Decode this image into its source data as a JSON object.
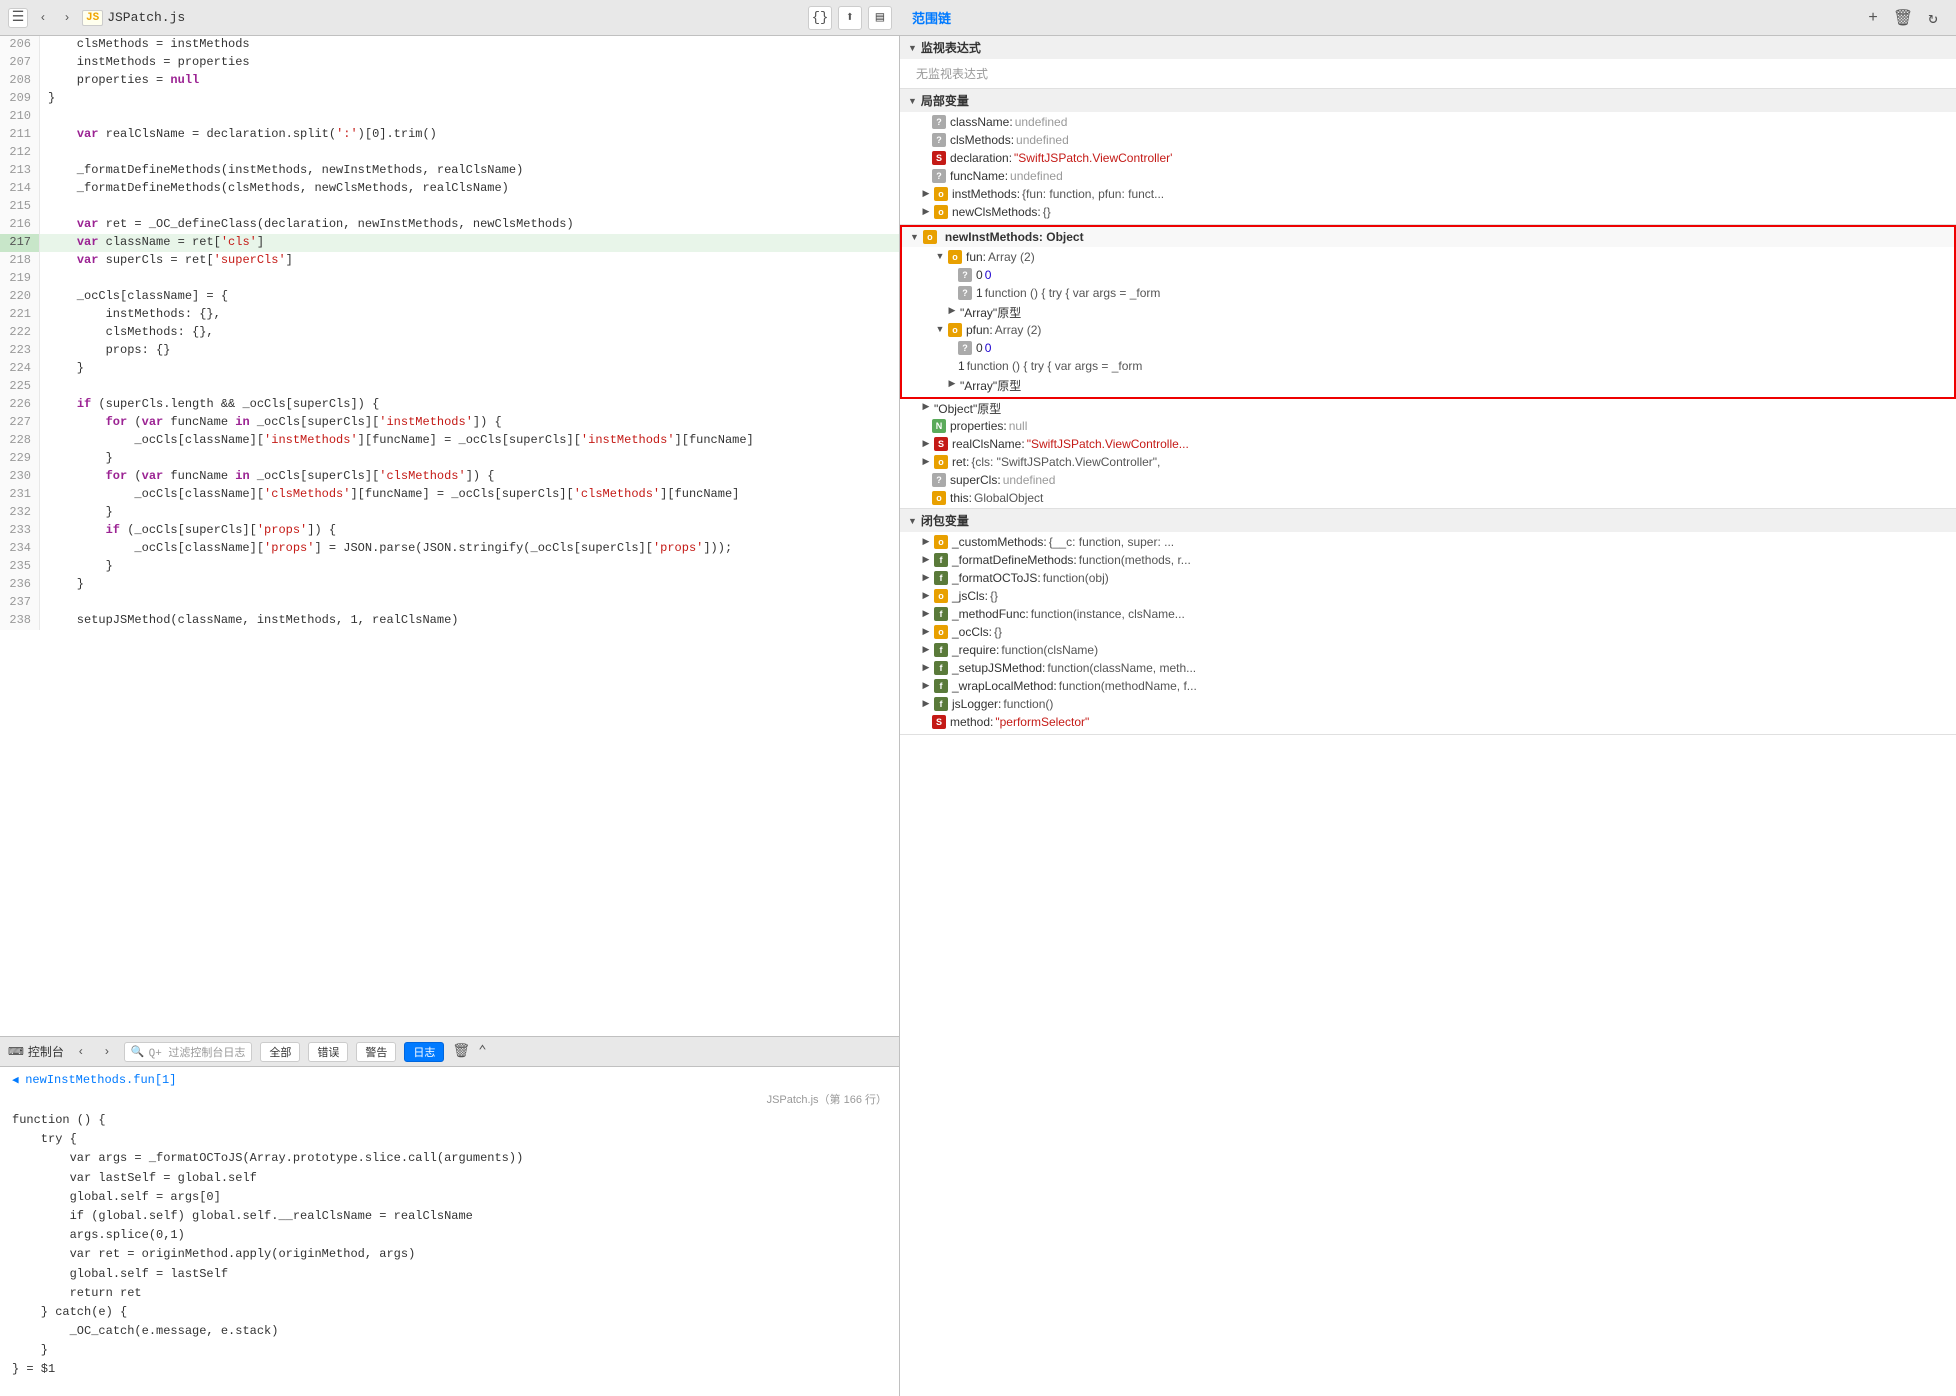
{
  "toolbar": {
    "left_icon": "≡",
    "back_arrow": "‹",
    "forward_arrow": "›",
    "js_icon": "JS",
    "filename": "JSPatch.js",
    "btn_braces": "{}",
    "btn_up": "⬆",
    "btn_sidebar": "▤"
  },
  "right_panel": {
    "title": "范围链",
    "add_icon": "+",
    "trash_icon": "🗑",
    "refresh_icon": "↻"
  },
  "watch_section": {
    "title": "监视表达式",
    "empty_text": "无监视表达式"
  },
  "local_section": {
    "title": "局部变量",
    "items": [
      {
        "icon": "q",
        "key": "className:",
        "val": "undefined",
        "val_type": "undef",
        "indent": 0
      },
      {
        "icon": "q",
        "key": "clsMethods:",
        "val": "undefined",
        "val_type": "undef",
        "indent": 0
      },
      {
        "icon": "s",
        "key": "declaration:",
        "val": "\"SwiftJSPatch.ViewController'",
        "val_type": "str",
        "indent": 0,
        "truncated": true
      },
      {
        "icon": "q",
        "key": "funcName:",
        "val": "undefined",
        "val_type": "undef",
        "indent": 0
      },
      {
        "icon": "o",
        "key": "instMethods:",
        "val": "{fun: function, pfun: funct...",
        "val_type": "obj",
        "indent": 0,
        "expandable": true
      },
      {
        "icon": "o",
        "key": "newClsMethods:",
        "val": "{}",
        "val_type": "obj",
        "indent": 0,
        "expandable": true
      }
    ]
  },
  "newInstMethods_section": {
    "expanded": true,
    "title": "newInstMethods: Object",
    "items": [
      {
        "icon": "o",
        "key": "fun:",
        "val": "Array (2)",
        "val_type": "obj",
        "indent": 1,
        "expandable": true,
        "expanded": true
      },
      {
        "icon": "num",
        "key": "0",
        "val": "0",
        "val_type": "num",
        "indent": 2,
        "num_val": "0"
      },
      {
        "icon": "num",
        "key": "1",
        "val": "function () { try { var args = _form",
        "val_type": "fn_text",
        "indent": 2
      },
      {
        "icon": null,
        "key": "\"Array\"原型",
        "val": "",
        "val_type": "proto",
        "indent": 2,
        "expandable": true
      },
      {
        "icon": "o",
        "key": "pfun:",
        "val": "Array (2)",
        "val_type": "obj",
        "indent": 1,
        "expandable": true,
        "expanded": true
      },
      {
        "icon": "num",
        "key": "0",
        "val": "0",
        "val_type": "num",
        "indent": 2,
        "num_val": "0"
      },
      {
        "icon": null,
        "key": "1",
        "val": "function () { try { var args = _form",
        "val_type": "fn_text",
        "indent": 2
      },
      {
        "icon": null,
        "key": "\"Array\"原型",
        "val": "",
        "val_type": "proto",
        "indent": 2,
        "expandable": true
      }
    ]
  },
  "local_section2": {
    "items": [
      {
        "icon": null,
        "key": "\"Object\"原型",
        "val": "",
        "val_type": "proto",
        "indent": 0,
        "expandable": true
      },
      {
        "icon": "n",
        "key": "properties:",
        "val": "null",
        "val_type": "null",
        "indent": 0
      },
      {
        "icon": "s",
        "key": "realClsName:",
        "val": "\"SwiftJSPatch.ViewControlle...",
        "val_type": "str",
        "indent": 0,
        "expandable": true
      },
      {
        "icon": "o",
        "key": "ret:",
        "val": "{cls: \"SwiftJSPatch.ViewController\",",
        "val_type": "obj",
        "indent": 0,
        "expandable": true
      },
      {
        "icon": "q",
        "key": "superCls:",
        "val": "undefined",
        "val_type": "undef",
        "indent": 0
      },
      {
        "icon": "o",
        "key": "this:",
        "val": "GlobalObject",
        "val_type": "obj",
        "indent": 0
      }
    ]
  },
  "closure_section": {
    "title": "闭包变量",
    "items": [
      {
        "icon": "o",
        "key": "_customMethods:",
        "val": "{__c: function, super: ...",
        "val_type": "obj",
        "indent": 0,
        "expandable": true
      },
      {
        "icon": "f",
        "key": "_formatDefineMethods:",
        "val": "function(methods, r...",
        "val_type": "fn",
        "indent": 0,
        "expandable": true
      },
      {
        "icon": "f",
        "key": "_formatOCToJS:",
        "val": "function(obj)",
        "val_type": "fn",
        "indent": 0,
        "expandable": true
      },
      {
        "icon": "o",
        "key": "_jsCls:",
        "val": "{}",
        "val_type": "obj",
        "indent": 0,
        "expandable": true
      },
      {
        "icon": "f",
        "key": "_methodFunc:",
        "val": "function(instance, clsName...",
        "val_type": "fn",
        "indent": 0,
        "expandable": true
      },
      {
        "icon": "o",
        "key": "_ocCls:",
        "val": "{}",
        "val_type": "obj",
        "indent": 0,
        "expandable": true
      },
      {
        "icon": "f",
        "key": "_require:",
        "val": "function(clsName)",
        "val_type": "fn",
        "indent": 0,
        "expandable": true
      },
      {
        "icon": "f",
        "key": "_setupJSMethod:",
        "val": "function(className, meth...",
        "val_type": "fn",
        "indent": 0,
        "expandable": true
      },
      {
        "icon": "f",
        "key": "_wrapLocalMethod:",
        "val": "function(methodName, f...",
        "val_type": "fn",
        "indent": 0,
        "expandable": true
      },
      {
        "icon": "f",
        "key": "jsLogger:",
        "val": "function()",
        "val_type": "fn",
        "indent": 0,
        "expandable": true
      },
      {
        "icon": "s",
        "key": "method:",
        "val": "\"performSelector\"",
        "val_type": "str",
        "indent": 0
      }
    ]
  },
  "console": {
    "title": "控制台",
    "filter_placeholder": "Q+ 过滤控制台日志",
    "btn_all": "全部",
    "btn_errors": "错误",
    "btn_warnings": "警告",
    "btn_logs": "日志",
    "stack_title": "newInstMethods.fun[1]",
    "location": "JSPatch.js（第 166 行）",
    "code": "function () {\n    try {\n        var args = _formatOCToJS(Array.prototype.slice.call(arguments))\n        var lastSelf = global.self\n        global.self = args[0]\n        if (global.self) global.self.__realClsName = realClsName\n        args.splice(0,1)\n        var ret = originMethod.apply(originMethod, args)\n        global.self = lastSelf\n        return ret\n    } catch(e) {\n        _OC_catch(e.message, e.stack)\n    }\n} = $1"
  },
  "code_lines": [
    {
      "num": 206,
      "content": "    clsMethods = instMethods",
      "highlight": false
    },
    {
      "num": 207,
      "content": "    instMethods = properties",
      "highlight": false
    },
    {
      "num": 208,
      "content": "    properties = null",
      "highlight": false
    },
    {
      "num": 209,
      "content": "}",
      "highlight": false
    },
    {
      "num": 210,
      "content": "",
      "highlight": false
    },
    {
      "num": 211,
      "content": "    var realClsName = declaration.split(':')[0].trim()",
      "highlight": false
    },
    {
      "num": 212,
      "content": "",
      "highlight": false
    },
    {
      "num": 213,
      "content": "    _formatDefineMethods(instMethods, newInstMethods, realClsName)",
      "highlight": false
    },
    {
      "num": 214,
      "content": "    _formatDefineMethods(clsMethods, newClsMethods, realClsName)",
      "highlight": false
    },
    {
      "num": 215,
      "content": "",
      "highlight": false
    },
    {
      "num": 216,
      "content": "    var ret = _OC_defineClass(declaration, newInstMethods, newClsMethods)",
      "highlight": false
    },
    {
      "num": 217,
      "content": "    var className = ret['cls']",
      "highlight": true
    },
    {
      "num": 218,
      "content": "    var superCls = ret['superCls']",
      "highlight": false
    },
    {
      "num": 219,
      "content": "",
      "highlight": false
    },
    {
      "num": 220,
      "content": "    _ocCls[className] = {",
      "highlight": false
    },
    {
      "num": 221,
      "content": "        instMethods: {},",
      "highlight": false
    },
    {
      "num": 222,
      "content": "        clsMethods: {},",
      "highlight": false
    },
    {
      "num": 223,
      "content": "        props: {}",
      "highlight": false
    },
    {
      "num": 224,
      "content": "    }",
      "highlight": false
    },
    {
      "num": 225,
      "content": "",
      "highlight": false
    },
    {
      "num": 226,
      "content": "    if (superCls.length && _ocCls[superCls]) {",
      "highlight": false
    },
    {
      "num": 227,
      "content": "        for (var funcName in _ocCls[superCls]['instMethods']) {",
      "highlight": false
    },
    {
      "num": 228,
      "content": "            _ocCls[className]['instMethods'][funcName] = _ocCls[superCls]['instMethods'][funcName]",
      "highlight": false
    },
    {
      "num": 229,
      "content": "        }",
      "highlight": false
    },
    {
      "num": 230,
      "content": "        for (var funcName in _ocCls[superCls]['clsMethods']) {",
      "highlight": false
    },
    {
      "num": 231,
      "content": "            _ocCls[className]['clsMethods'][funcName] = _ocCls[superCls]['clsMethods'][funcName]",
      "highlight": false
    },
    {
      "num": 232,
      "content": "        }",
      "highlight": false
    },
    {
      "num": 233,
      "content": "        if (_ocCls[superCls]['props']) {",
      "highlight": false
    },
    {
      "num": 234,
      "content": "            _ocCls[className]['props'] = JSON.parse(JSON.stringify(_ocCls[superCls]['props']));",
      "highlight": false
    },
    {
      "num": 235,
      "content": "        }",
      "highlight": false
    },
    {
      "num": 236,
      "content": "    }",
      "highlight": false
    },
    {
      "num": 237,
      "content": "",
      "highlight": false
    },
    {
      "num": 238,
      "content": "    setupJSMethod(className, instMethods, 1, realClsName)",
      "highlight": false
    }
  ]
}
